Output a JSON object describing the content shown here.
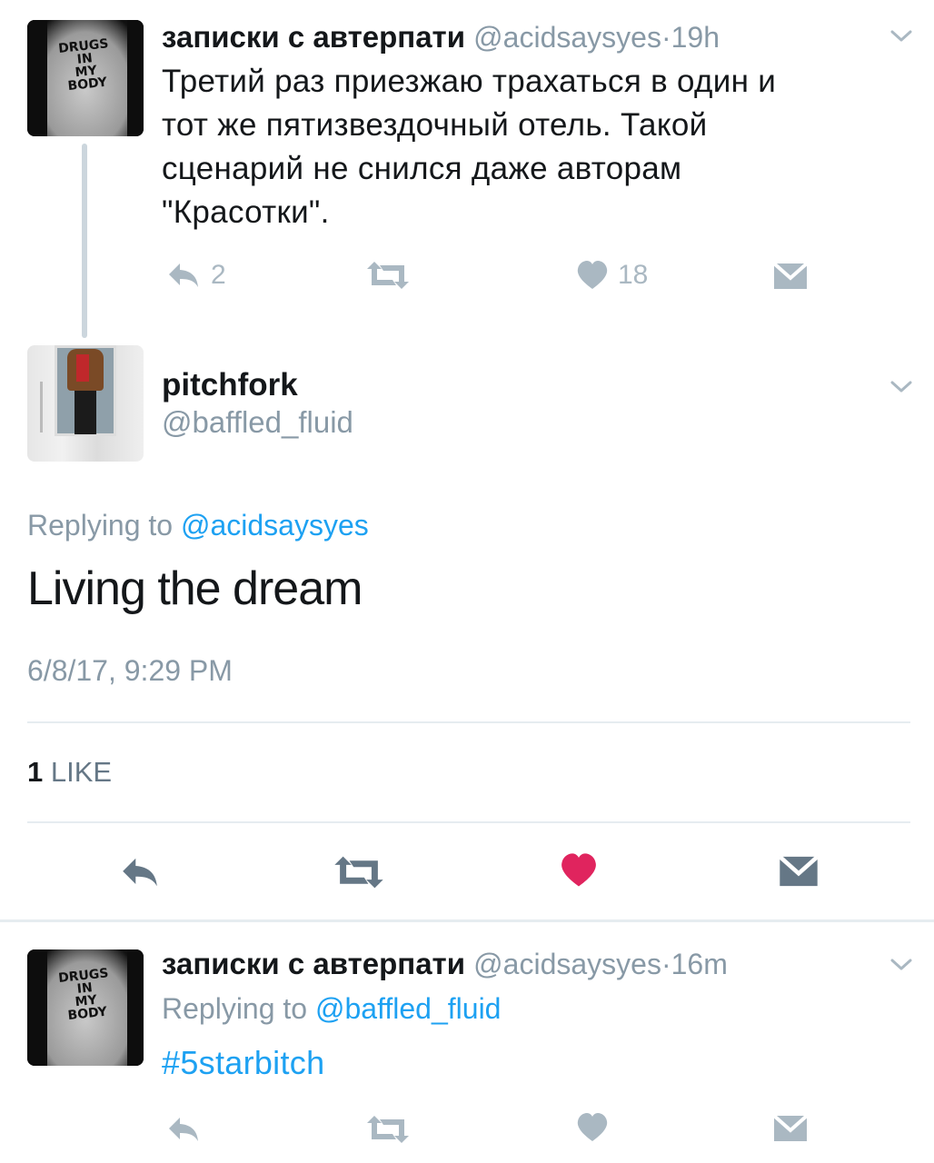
{
  "tweet1": {
    "display_name": "записки с автерпати",
    "handle": "@acidsaysyes",
    "separator": "·",
    "time": "19h",
    "avatar_text": "DRUGS\nIN\nMY\nBODY",
    "text_lines": [
      "Третий раз приезжаю трахаться в один и",
      "тот же пятизвездочный отель. Такой",
      "сценарий не снился даже авторам",
      "\"Красотки\"."
    ],
    "reply_count": "2",
    "like_count": "18"
  },
  "main_tweet": {
    "display_name": "pitchfork",
    "handle": "@baffled_fluid",
    "replying_prefix": "Replying to",
    "replying_handle": "@acidsaysyes",
    "text": "Living the dream",
    "timestamp": "6/8/17, 9:29 PM",
    "likes_number": "1",
    "likes_label": "LIKE"
  },
  "tweet3": {
    "display_name": "записки с автерпати",
    "handle": "@acidsaysyes",
    "separator": "·",
    "time": "16m",
    "avatar_text": "DRUGS\nIN\nMY\nBODY",
    "replying_prefix": "Replying to",
    "replying_handle": "@baffled_fluid",
    "hashtag": "#5starbitch"
  },
  "colors": {
    "muted": "#8899a6",
    "action_gray": "#aab8c2",
    "link": "#1da1f2",
    "like_red": "#e0245e",
    "main_action": "#657786"
  },
  "icons": [
    "reply-icon",
    "retweet-icon",
    "heart-icon",
    "direct-message-icon",
    "chevron-down-icon"
  ]
}
